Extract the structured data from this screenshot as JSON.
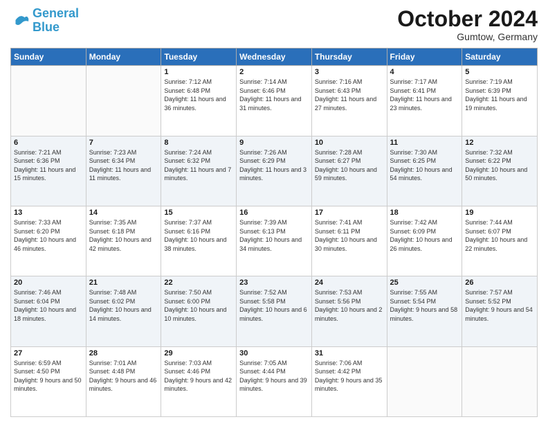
{
  "header": {
    "logo_general": "General",
    "logo_blue": "Blue",
    "title": "October 2024",
    "location": "Gumtow, Germany"
  },
  "weekdays": [
    "Sunday",
    "Monday",
    "Tuesday",
    "Wednesday",
    "Thursday",
    "Friday",
    "Saturday"
  ],
  "weeks": [
    [
      {
        "day": "",
        "sunrise": "",
        "sunset": "",
        "daylight": ""
      },
      {
        "day": "",
        "sunrise": "",
        "sunset": "",
        "daylight": ""
      },
      {
        "day": "1",
        "sunrise": "Sunrise: 7:12 AM",
        "sunset": "Sunset: 6:48 PM",
        "daylight": "Daylight: 11 hours and 36 minutes."
      },
      {
        "day": "2",
        "sunrise": "Sunrise: 7:14 AM",
        "sunset": "Sunset: 6:46 PM",
        "daylight": "Daylight: 11 hours and 31 minutes."
      },
      {
        "day": "3",
        "sunrise": "Sunrise: 7:16 AM",
        "sunset": "Sunset: 6:43 PM",
        "daylight": "Daylight: 11 hours and 27 minutes."
      },
      {
        "day": "4",
        "sunrise": "Sunrise: 7:17 AM",
        "sunset": "Sunset: 6:41 PM",
        "daylight": "Daylight: 11 hours and 23 minutes."
      },
      {
        "day": "5",
        "sunrise": "Sunrise: 7:19 AM",
        "sunset": "Sunset: 6:39 PM",
        "daylight": "Daylight: 11 hours and 19 minutes."
      }
    ],
    [
      {
        "day": "6",
        "sunrise": "Sunrise: 7:21 AM",
        "sunset": "Sunset: 6:36 PM",
        "daylight": "Daylight: 11 hours and 15 minutes."
      },
      {
        "day": "7",
        "sunrise": "Sunrise: 7:23 AM",
        "sunset": "Sunset: 6:34 PM",
        "daylight": "Daylight: 11 hours and 11 minutes."
      },
      {
        "day": "8",
        "sunrise": "Sunrise: 7:24 AM",
        "sunset": "Sunset: 6:32 PM",
        "daylight": "Daylight: 11 hours and 7 minutes."
      },
      {
        "day": "9",
        "sunrise": "Sunrise: 7:26 AM",
        "sunset": "Sunset: 6:29 PM",
        "daylight": "Daylight: 11 hours and 3 minutes."
      },
      {
        "day": "10",
        "sunrise": "Sunrise: 7:28 AM",
        "sunset": "Sunset: 6:27 PM",
        "daylight": "Daylight: 10 hours and 59 minutes."
      },
      {
        "day": "11",
        "sunrise": "Sunrise: 7:30 AM",
        "sunset": "Sunset: 6:25 PM",
        "daylight": "Daylight: 10 hours and 54 minutes."
      },
      {
        "day": "12",
        "sunrise": "Sunrise: 7:32 AM",
        "sunset": "Sunset: 6:22 PM",
        "daylight": "Daylight: 10 hours and 50 minutes."
      }
    ],
    [
      {
        "day": "13",
        "sunrise": "Sunrise: 7:33 AM",
        "sunset": "Sunset: 6:20 PM",
        "daylight": "Daylight: 10 hours and 46 minutes."
      },
      {
        "day": "14",
        "sunrise": "Sunrise: 7:35 AM",
        "sunset": "Sunset: 6:18 PM",
        "daylight": "Daylight: 10 hours and 42 minutes."
      },
      {
        "day": "15",
        "sunrise": "Sunrise: 7:37 AM",
        "sunset": "Sunset: 6:16 PM",
        "daylight": "Daylight: 10 hours and 38 minutes."
      },
      {
        "day": "16",
        "sunrise": "Sunrise: 7:39 AM",
        "sunset": "Sunset: 6:13 PM",
        "daylight": "Daylight: 10 hours and 34 minutes."
      },
      {
        "day": "17",
        "sunrise": "Sunrise: 7:41 AM",
        "sunset": "Sunset: 6:11 PM",
        "daylight": "Daylight: 10 hours and 30 minutes."
      },
      {
        "day": "18",
        "sunrise": "Sunrise: 7:42 AM",
        "sunset": "Sunset: 6:09 PM",
        "daylight": "Daylight: 10 hours and 26 minutes."
      },
      {
        "day": "19",
        "sunrise": "Sunrise: 7:44 AM",
        "sunset": "Sunset: 6:07 PM",
        "daylight": "Daylight: 10 hours and 22 minutes."
      }
    ],
    [
      {
        "day": "20",
        "sunrise": "Sunrise: 7:46 AM",
        "sunset": "Sunset: 6:04 PM",
        "daylight": "Daylight: 10 hours and 18 minutes."
      },
      {
        "day": "21",
        "sunrise": "Sunrise: 7:48 AM",
        "sunset": "Sunset: 6:02 PM",
        "daylight": "Daylight: 10 hours and 14 minutes."
      },
      {
        "day": "22",
        "sunrise": "Sunrise: 7:50 AM",
        "sunset": "Sunset: 6:00 PM",
        "daylight": "Daylight: 10 hours and 10 minutes."
      },
      {
        "day": "23",
        "sunrise": "Sunrise: 7:52 AM",
        "sunset": "Sunset: 5:58 PM",
        "daylight": "Daylight: 10 hours and 6 minutes."
      },
      {
        "day": "24",
        "sunrise": "Sunrise: 7:53 AM",
        "sunset": "Sunset: 5:56 PM",
        "daylight": "Daylight: 10 hours and 2 minutes."
      },
      {
        "day": "25",
        "sunrise": "Sunrise: 7:55 AM",
        "sunset": "Sunset: 5:54 PM",
        "daylight": "Daylight: 9 hours and 58 minutes."
      },
      {
        "day": "26",
        "sunrise": "Sunrise: 7:57 AM",
        "sunset": "Sunset: 5:52 PM",
        "daylight": "Daylight: 9 hours and 54 minutes."
      }
    ],
    [
      {
        "day": "27",
        "sunrise": "Sunrise: 6:59 AM",
        "sunset": "Sunset: 4:50 PM",
        "daylight": "Daylight: 9 hours and 50 minutes."
      },
      {
        "day": "28",
        "sunrise": "Sunrise: 7:01 AM",
        "sunset": "Sunset: 4:48 PM",
        "daylight": "Daylight: 9 hours and 46 minutes."
      },
      {
        "day": "29",
        "sunrise": "Sunrise: 7:03 AM",
        "sunset": "Sunset: 4:46 PM",
        "daylight": "Daylight: 9 hours and 42 minutes."
      },
      {
        "day": "30",
        "sunrise": "Sunrise: 7:05 AM",
        "sunset": "Sunset: 4:44 PM",
        "daylight": "Daylight: 9 hours and 39 minutes."
      },
      {
        "day": "31",
        "sunrise": "Sunrise: 7:06 AM",
        "sunset": "Sunset: 4:42 PM",
        "daylight": "Daylight: 9 hours and 35 minutes."
      },
      {
        "day": "",
        "sunrise": "",
        "sunset": "",
        "daylight": ""
      },
      {
        "day": "",
        "sunrise": "",
        "sunset": "",
        "daylight": ""
      }
    ]
  ]
}
